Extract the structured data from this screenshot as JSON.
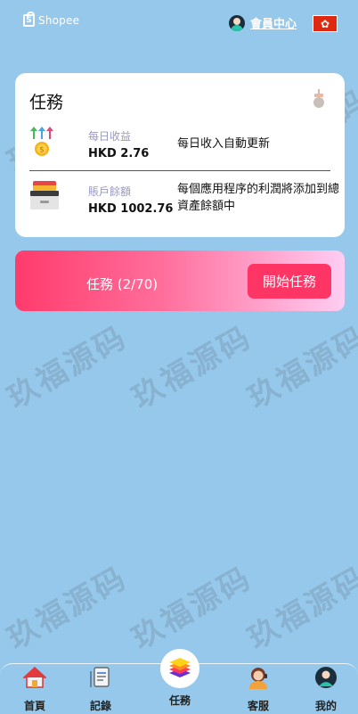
{
  "header": {
    "brand": "Shopee",
    "member_label": "會員中心"
  },
  "task_card": {
    "title": "任務",
    "daily": {
      "label": "每日收益",
      "value": "HKD 2.76",
      "desc": "每日收入自動更新"
    },
    "balance": {
      "label": "賬戶餘額",
      "value": "HKD 1002.76",
      "desc": "每個應用程序的利潤將添加到總資產餘額中"
    }
  },
  "task_bar": {
    "count_label": "任務 (2/70)",
    "start_label": "開始任務"
  },
  "watermark": "玖福源码",
  "bottom_nav": {
    "items": [
      {
        "label": "首頁",
        "icon": "home-icon"
      },
      {
        "label": "記錄",
        "icon": "records-icon"
      },
      {
        "label": "任務",
        "icon": "tasks-icon"
      },
      {
        "label": "客服",
        "icon": "support-icon"
      },
      {
        "label": "我的",
        "icon": "profile-icon"
      }
    ]
  },
  "colors": {
    "background": "#95c8ea",
    "accent": "#ff3565",
    "label_purple": "#9a98c2"
  }
}
